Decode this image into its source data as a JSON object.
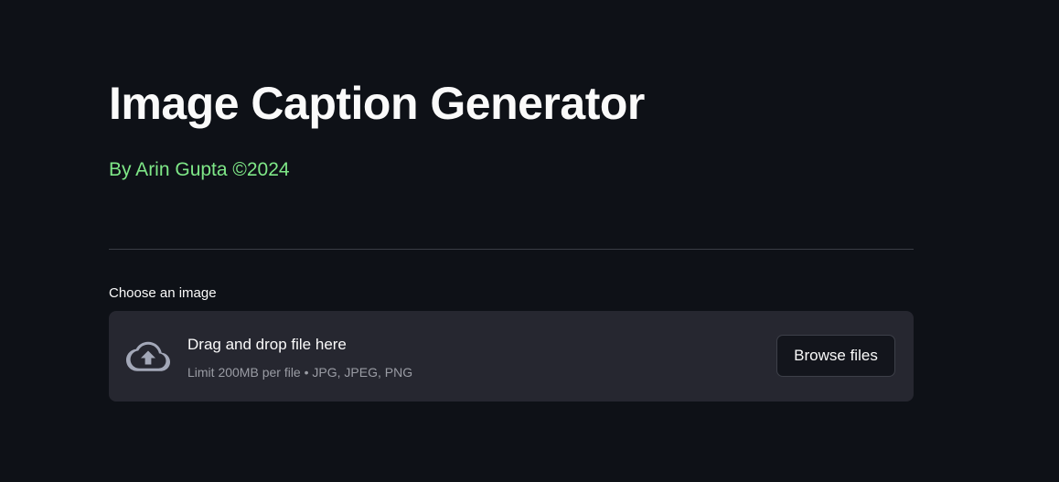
{
  "header": {
    "title": "Image Caption Generator",
    "subtitle": "By Arin Gupta ©2024"
  },
  "uploader": {
    "label": "Choose an image",
    "drop_text": "Drag and drop file here",
    "limit_text": "Limit 200MB per file • JPG, JPEG, PNG",
    "browse_label": "Browse files",
    "icon": "cloud-upload-icon"
  },
  "colors": {
    "background": "#0e1117",
    "subtitle": "#7ee787",
    "dropzone": "#262730",
    "muted_text": "#9a9ca4"
  }
}
